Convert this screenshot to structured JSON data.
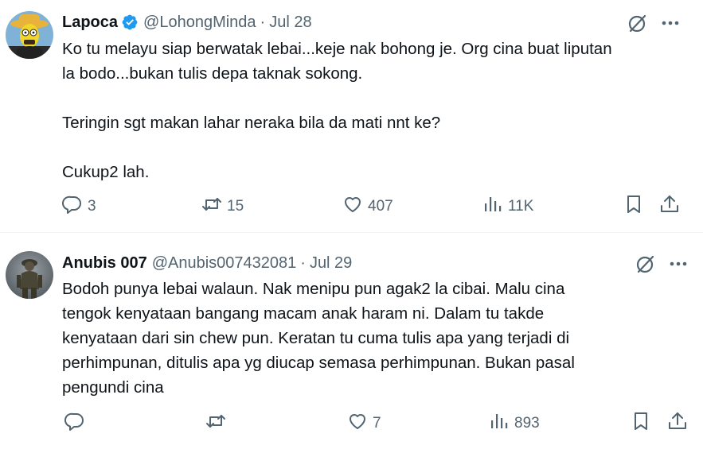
{
  "tweets": [
    {
      "author_name": "Lapoca",
      "verified": true,
      "handle": "@LohongMinda",
      "separator": "·",
      "date": "Jul 28",
      "text": "Ko tu melayu siap berwatak lebai...keje nak bohong je. Org cina buat liputan\nla bodo...bukan tulis depa taknak sokong.\n\nTeringin sgt makan lahar neraka bila da mati nnt ke?\n\nCukup2 lah.",
      "replies": "3",
      "reposts": "15",
      "likes": "407",
      "views": "11K",
      "avatar_icon": "cartoon-avatar"
    },
    {
      "author_name": "Anubis 007",
      "verified": false,
      "handle": "@Anubis007432081",
      "separator": "·",
      "date": "Jul 29",
      "text": "Bodoh punya lebai walaun. Nak menipu pun agak2 la cibai. Malu cina\ntengok kenyataan bangang macam anak haram ni. Dalam tu takde\nkenyataan dari sin chew pun. Keratan tu cuma tulis apa yang terjadi di\nperhimpunan, ditulis apa yg diucap semasa perhimpunan. Bukan pasal\npengundi cina",
      "replies": "",
      "reposts": "",
      "likes": "7",
      "views": "893",
      "avatar_icon": "soldier-avatar"
    }
  ],
  "colors": {
    "text": "#0f1419",
    "muted": "#536471",
    "verified": "#1d9bf0",
    "divider": "#eff3f4"
  }
}
